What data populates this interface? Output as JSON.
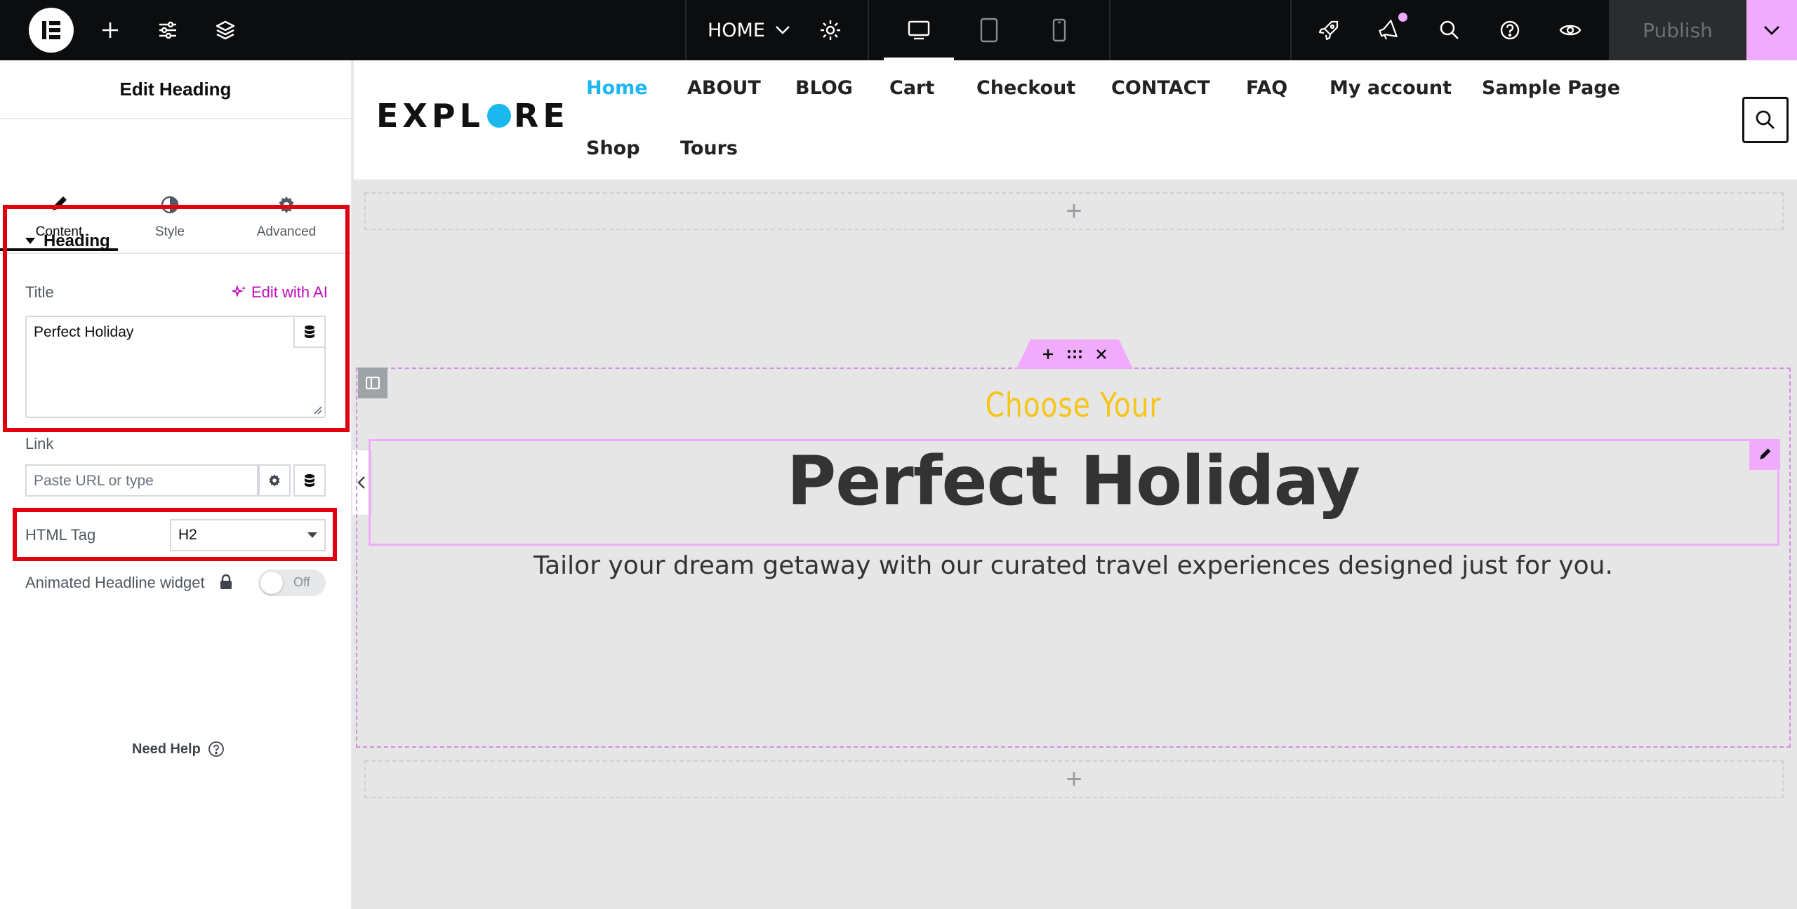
{
  "topbar": {
    "page_name": "HOME",
    "publish_label": "Publish",
    "icons": [
      "elementor-logo-icon",
      "add-icon",
      "sliders-icon",
      "layers-icon",
      "chevron-down-icon",
      "gear-icon",
      "desktop-icon",
      "tablet-icon",
      "mobile-icon",
      "rocket-icon",
      "megaphone-icon",
      "search-icon",
      "help-icon",
      "eye-icon"
    ]
  },
  "panel": {
    "title": "Edit Heading",
    "tabs": [
      {
        "label": "Content",
        "icon": "pencil-icon",
        "active": true
      },
      {
        "label": "Style",
        "icon": "half-circle-icon",
        "active": false
      },
      {
        "label": "Advanced",
        "icon": "gear-icon",
        "active": false
      }
    ],
    "section_title": "Heading",
    "title_label": "Title",
    "edit_ai_label": "Edit with AI",
    "title_value": "Perfect Holiday",
    "link_label": "Link",
    "link_placeholder": "Paste URL or type",
    "html_tag_label": "HTML Tag",
    "html_tag_value": "H2",
    "animated_label": "Animated Headline widget",
    "toggle_label": "Off",
    "need_help": "Need Help"
  },
  "site": {
    "brand_left": "EXPL",
    "brand_right": "RE",
    "nav": [
      "Home",
      "ABOUT",
      "BLOG",
      "Cart",
      "Checkout",
      "CONTACT",
      "FAQ",
      "My account",
      "Sample Page",
      "Shop",
      "Tours"
    ],
    "active_nav": "Home"
  },
  "content": {
    "subheading": "Choose Your",
    "heading": "Perfect Holiday",
    "paragraph": "Tailor your dream getaway with our curated travel experiences designed just for you.",
    "add_section": "+"
  },
  "colors": {
    "accent_pink": "#f0abfc",
    "nav_active": "#1bb7ef",
    "subheading": "#f5c518",
    "highlight_red": "#e0000f",
    "ai_magenta": "#c00bb9"
  }
}
